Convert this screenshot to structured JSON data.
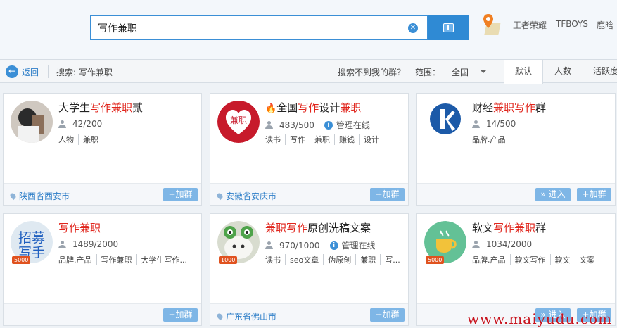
{
  "search": {
    "query": "写作兼职"
  },
  "hot_keywords": [
    "王者荣耀",
    "TFBOYS",
    "鹿晗"
  ],
  "bar": {
    "back_label": "返回",
    "search_label": "搜索: 写作兼职",
    "not_found_label": "搜索不到我的群？",
    "scope_label": "范围：",
    "scope_value": "全国",
    "sort_tabs": [
      "默认",
      "人数",
      "活跃度"
    ]
  },
  "buttons": {
    "join": "+加群",
    "enter": "» 进入"
  },
  "cards": [
    {
      "name_parts": [
        "大学生",
        "写作兼职",
        "贰"
      ],
      "members": "42/200",
      "managed": "",
      "tags": [
        "人物",
        "兼职"
      ],
      "location": "陕西省西安市",
      "level": "",
      "has_enter": false
    },
    {
      "name_parts": [
        "全国",
        "写作",
        "设计",
        "兼职"
      ],
      "members": "483/500",
      "managed": "管理在线",
      "tags": [
        "读书",
        "写作",
        "兼职",
        "赚钱",
        "设计"
      ],
      "location": "安徽省安庆市",
      "level": "",
      "has_enter": false
    },
    {
      "name_parts": [
        "财经",
        "兼职写作",
        "群"
      ],
      "members": "14/500",
      "managed": "",
      "tags": [
        "品牌.产品"
      ],
      "location": "",
      "level": "",
      "has_enter": true
    },
    {
      "name_parts": [
        "写作兼职"
      ],
      "members": "1489/2000",
      "managed": "",
      "tags": [
        "品牌.产品",
        "写作兼职",
        "大学生写作..."
      ],
      "location": "",
      "level": "5000",
      "has_enter": false
    },
    {
      "name_parts": [
        "兼职写作",
        "原创洗稿文案"
      ],
      "members": "970/1000",
      "managed": "管理在线",
      "tags": [
        "读书",
        "seo文章",
        "伪原创",
        "兼职",
        "写..."
      ],
      "location": "广东省佛山市",
      "level": "1000",
      "has_enter": false
    },
    {
      "name_parts": [
        "软文",
        "写作兼职",
        "群"
      ],
      "members": "1034/2000",
      "managed": "",
      "tags": [
        "品牌.产品",
        "软文写作",
        "软文",
        "文案"
      ],
      "location": "",
      "level": "5000",
      "has_enter": true
    }
  ],
  "colors": {
    "accent": "#2f8ad4",
    "highlight": "#e0241b",
    "button": "#7eb6e6"
  },
  "watermark": "www.maiyudu.com"
}
